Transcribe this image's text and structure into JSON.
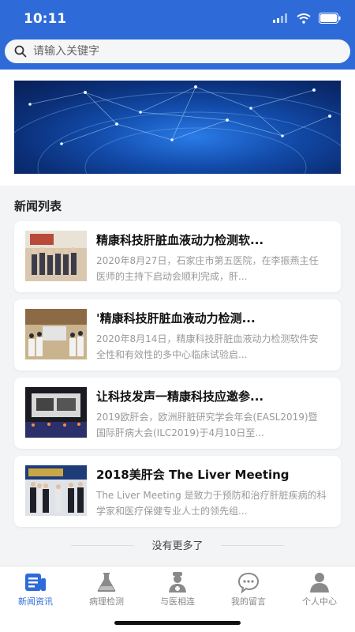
{
  "status": {
    "time": "10:11"
  },
  "search": {
    "placeholder": "请输入关键字"
  },
  "section_title": "新闻列表",
  "news": [
    {
      "title": "精康科技肝脏血液动力检测软...",
      "summary": "2020年8月27日，石家庄市第五医院，在李振燕主任医师的主持下启动会顺利完成，肝..."
    },
    {
      "title": "'精康科技肝脏血液动力检测...",
      "summary": "2020年8月14日，精康科技肝脏血液动力检测软件安全性和有效性的多中心临床试验启..."
    },
    {
      "title": "让科技发声一精康科技应邀参...",
      "summary": "2019欧肝会，欧洲肝脏研究学会年会(EASL2019)暨国际肝病大会(ILC2019)于4月10日至..."
    },
    {
      "title": "2018美肝会 The Liver Meeting",
      "summary": "The Liver Meeting 是致力于预防和治疗肝脏疾病的科学家和医疗保健专业人士的领先组..."
    }
  ],
  "no_more": "没有更多了",
  "tabs": [
    {
      "label": "新闻资讯",
      "icon": "news-icon",
      "active": true
    },
    {
      "label": "病理检测",
      "icon": "flask-icon",
      "active": false
    },
    {
      "label": "与医相连",
      "icon": "doctor-icon",
      "active": false
    },
    {
      "label": "我的留言",
      "icon": "message-icon",
      "active": false
    },
    {
      "label": "个人中心",
      "icon": "user-icon",
      "active": false
    }
  ],
  "colors": {
    "primary": "#2f6bd8",
    "background": "#f3f4f6",
    "muted": "#999999"
  }
}
